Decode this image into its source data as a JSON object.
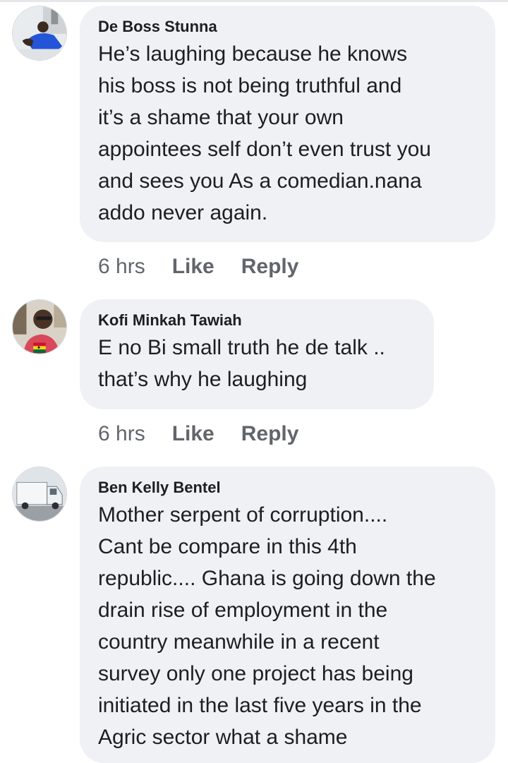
{
  "comments": [
    {
      "author": "De Boss Stunna",
      "lines": [
        "He’s laughing because he knows",
        "his boss is not being truthful and",
        "it’s a shame that your own",
        "appointees self don’t even trust you",
        "and sees you As a comedian.nana",
        "addo never again."
      ],
      "time": "6 hrs",
      "like_label": "Like",
      "reply_label": "Reply"
    },
    {
      "author": "Kofi Minkah Tawiah",
      "lines": [
        "E no Bi small truth he de talk ..",
        "that’s why he laughing"
      ],
      "time": "6 hrs",
      "like_label": "Like",
      "reply_label": "Reply"
    },
    {
      "author": "Ben Kelly Bentel",
      "lines": [
        "Mother serpent of corruption....",
        "Cant be compare in this 4th",
        "republic.... Ghana is going down the",
        "drain rise of employment in the",
        "country meanwhile in a recent",
        "survey only one project has being",
        "initiated in the last five years in the",
        "Agric sector what a shame"
      ]
    }
  ],
  "colors": {
    "bubble": "#f0f1f5",
    "text": "#1c1e21",
    "meta": "#62656b"
  }
}
